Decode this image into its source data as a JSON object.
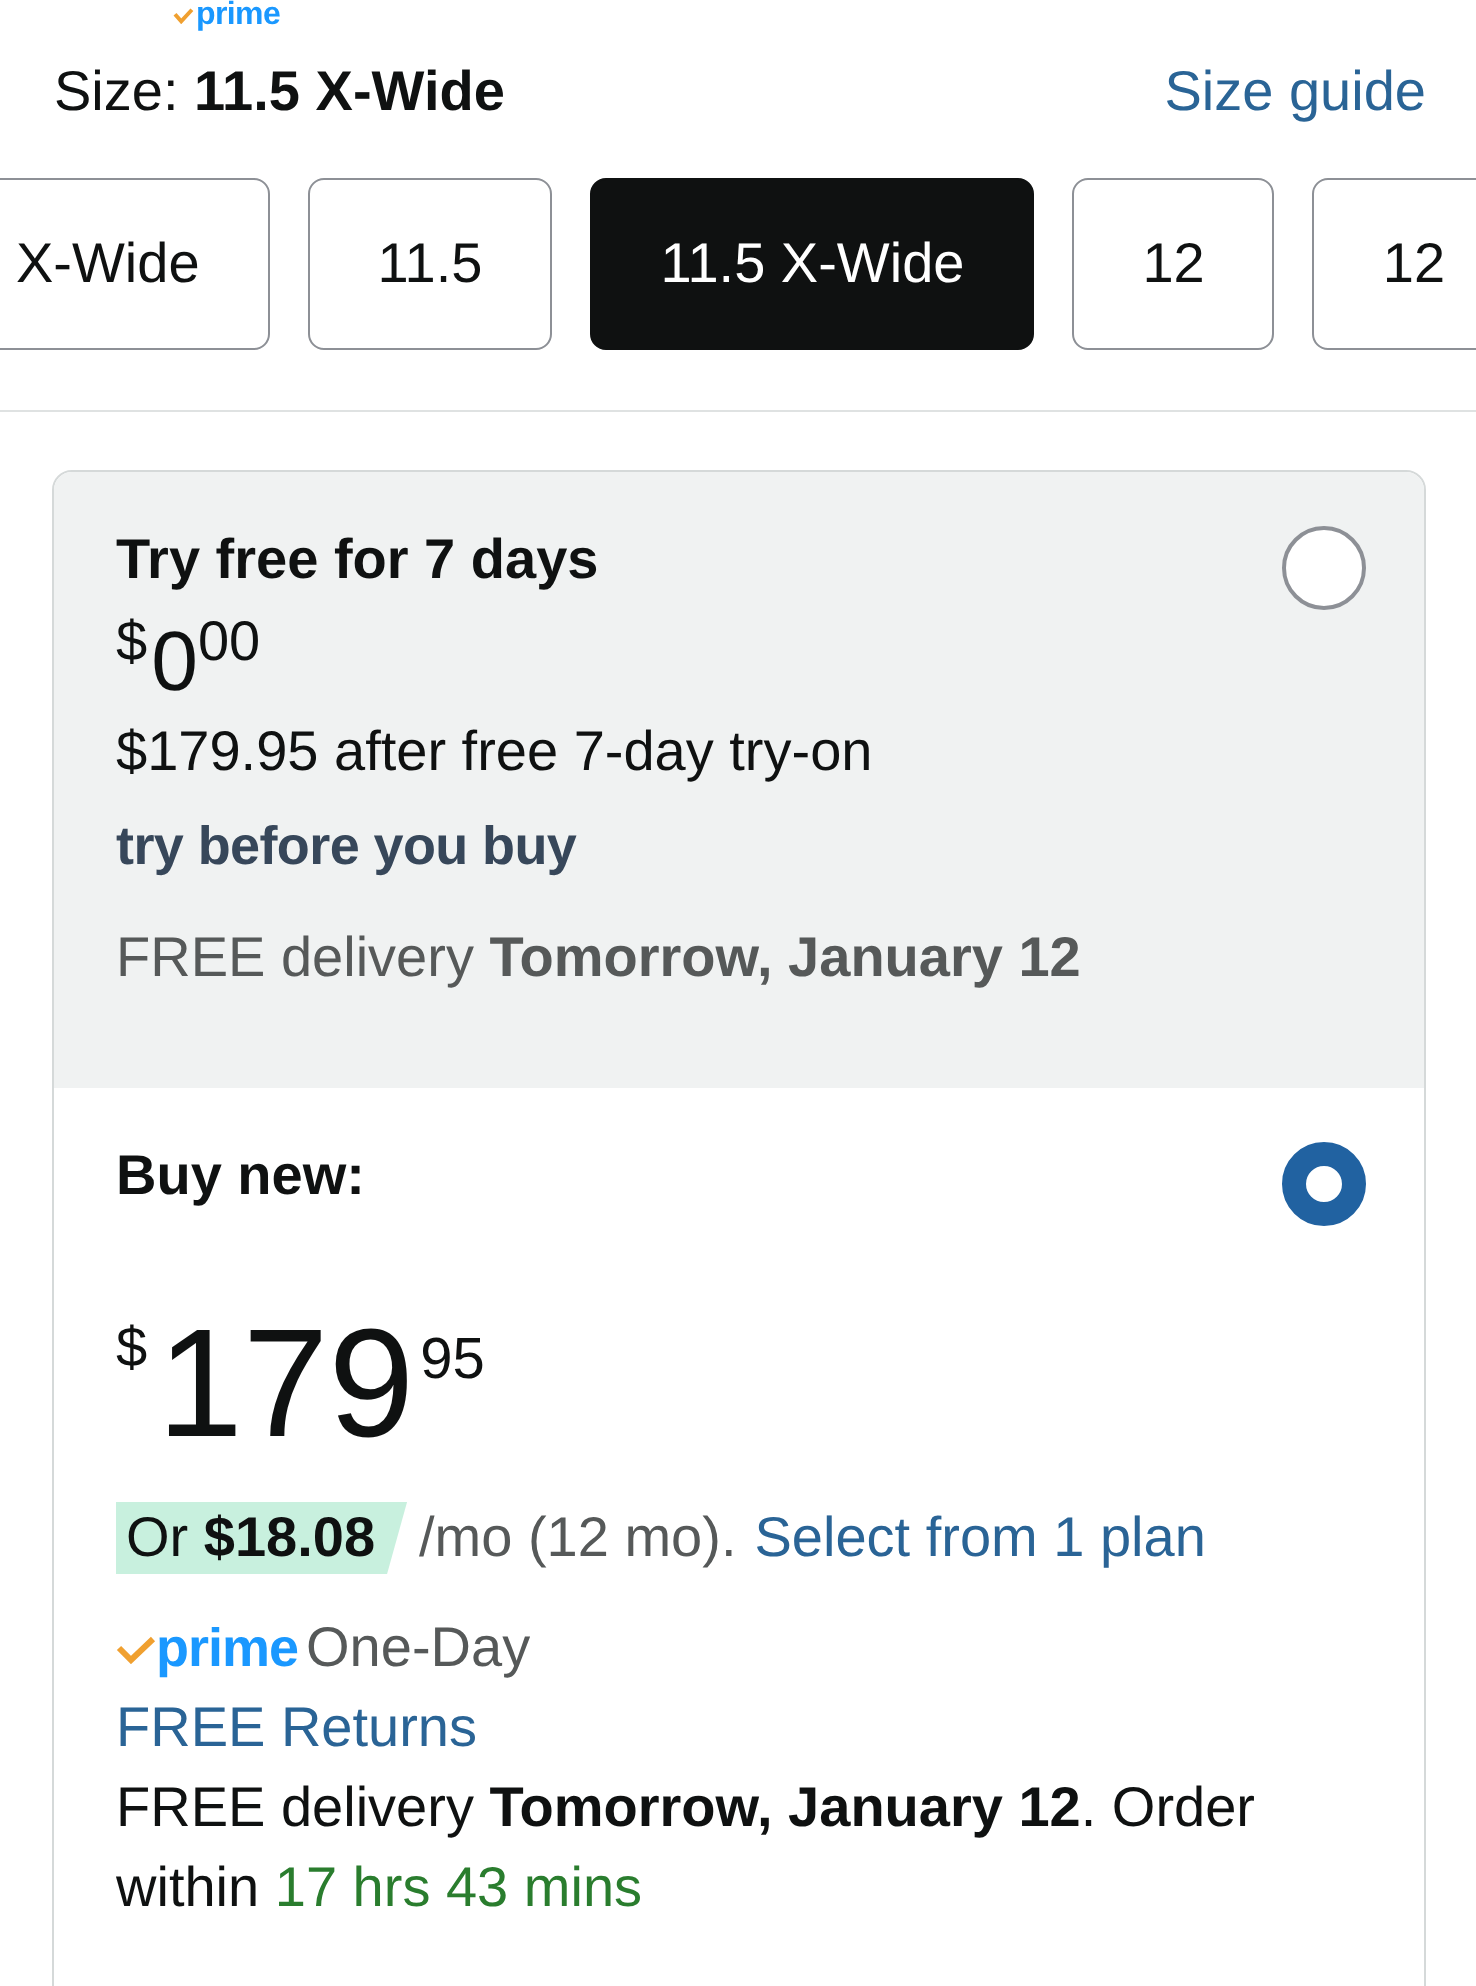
{
  "header_badge": {
    "logo": "prime"
  },
  "size_selector": {
    "selection": "Size: **11.5 X-Wide**",
    "guide_link": "Size guide",
    "options": [
      {
        "label": "X-Wide",
        "selected": false
      },
      {
        "label": "11.5",
        "selected": false
      },
      {
        "label": "11.5 X-Wide",
        "selected": true
      },
      {
        "label": "12",
        "selected": false
      },
      {
        "label": "12",
        "selected": false
      }
    ]
  },
  "purchase_options": [
    {
      "kind": "try",
      "selected": false,
      "title": "Try free for 7 days",
      "price": {
        "symbol": "$",
        "whole": "0",
        "fraction": "00"
      },
      "price_note": "$179.95 after free 7-day try-on",
      "tagline": "try before you buy",
      "delivery": "FREE delivery **Tomorrow, January 12**"
    },
    {
      "kind": "buy",
      "selected": true,
      "title": "Buy new:",
      "price": {
        "symbol": "$",
        "whole": "179",
        "fraction": "95"
      },
      "monthly": {
        "amount": "Or **$18.08**",
        "term": "/mo (12 mo).",
        "link": "Select from 1 plan"
      },
      "prime": {
        "logo": "prime",
        "speed": "One-Day"
      },
      "returns_link": "FREE Returns",
      "delivery": "FREE delivery **Tomorrow, January 12**. Order within",
      "countdown": "17 hrs 43 mins"
    }
  ]
}
